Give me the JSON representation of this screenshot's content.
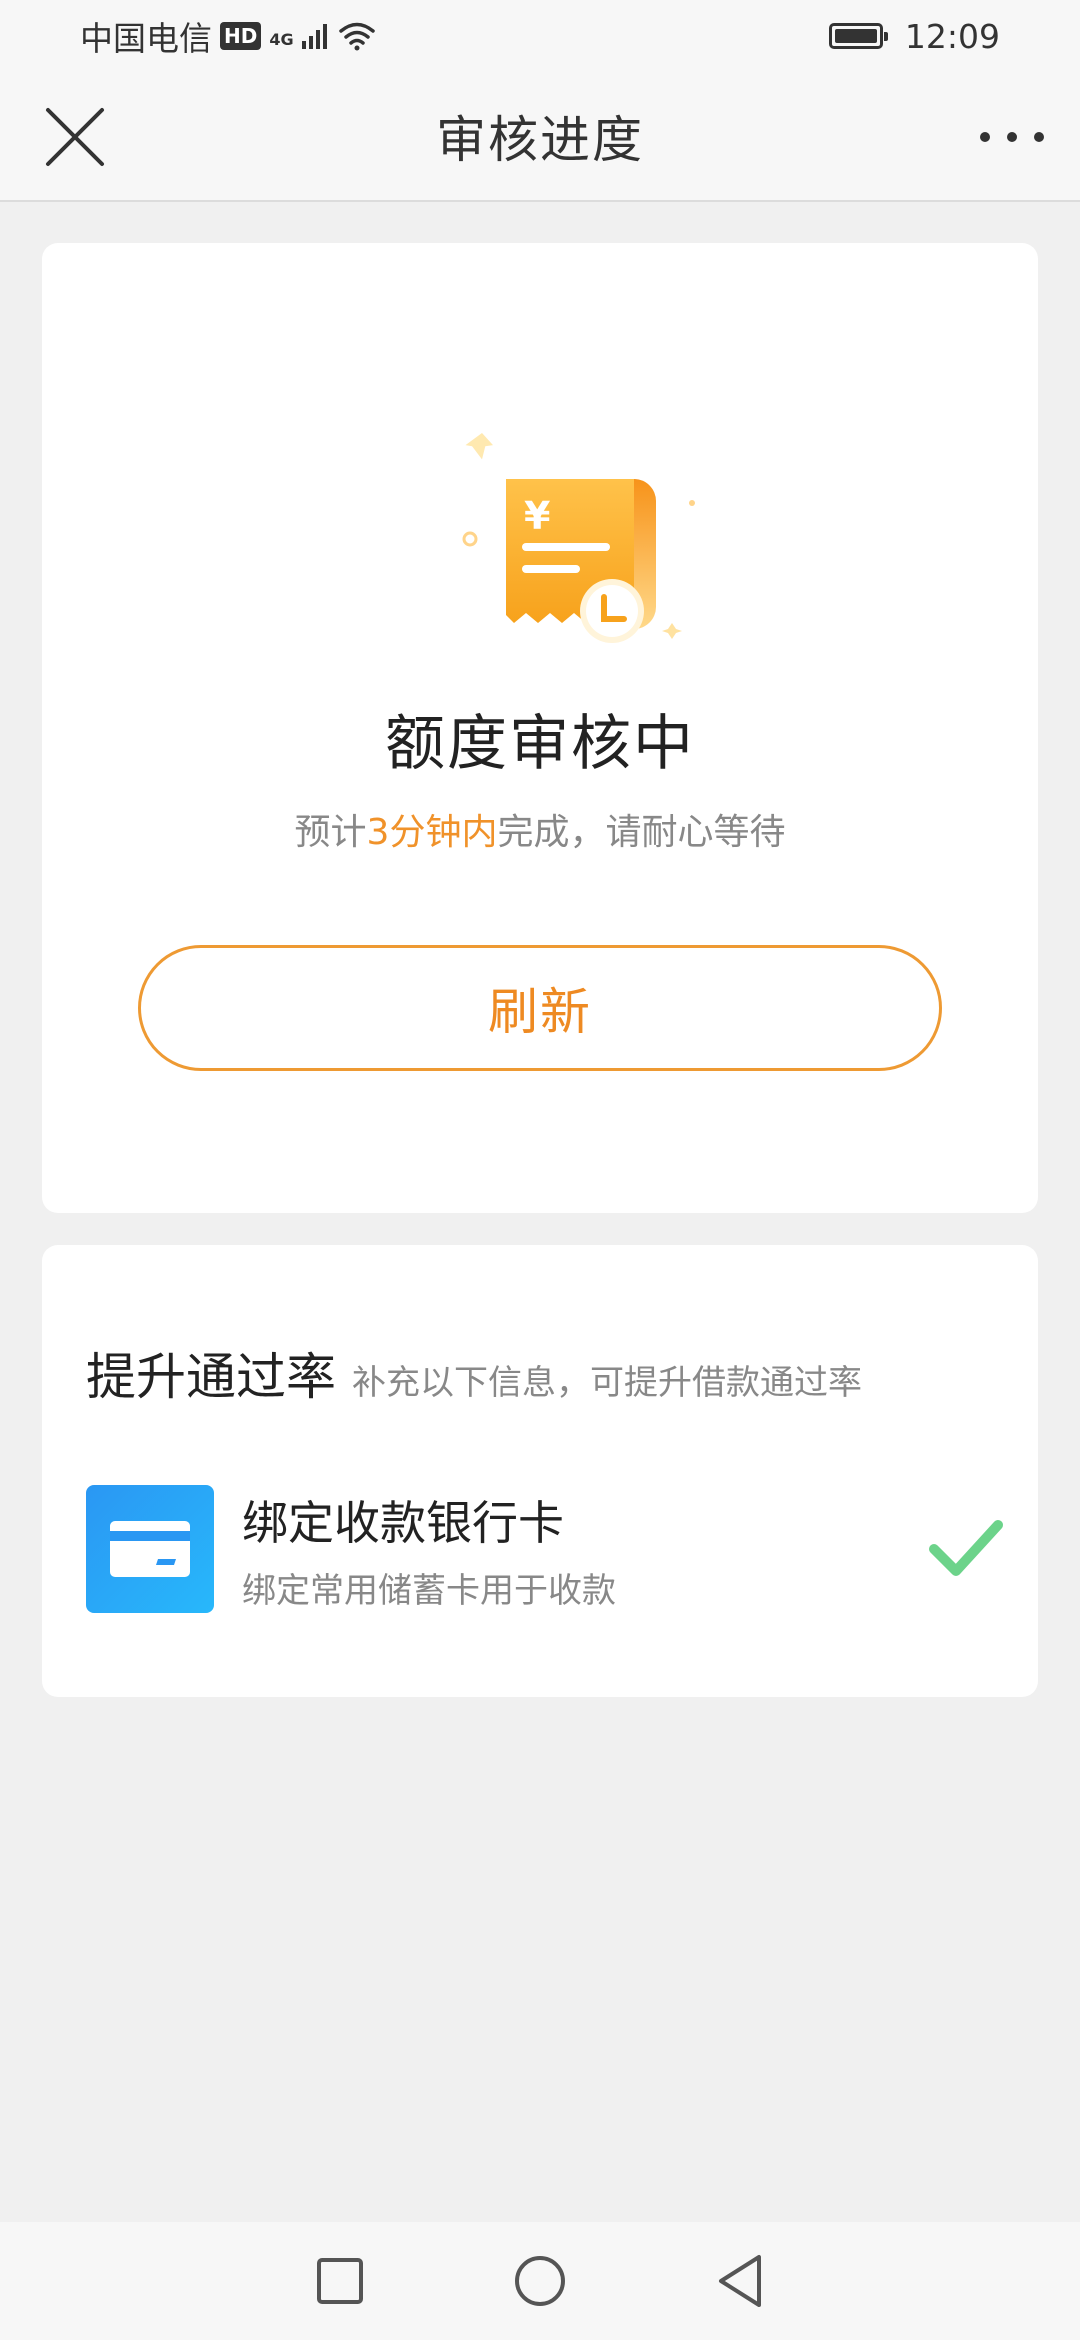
{
  "status_bar": {
    "carrier": "中国电信",
    "hd": "HD",
    "net": "4G",
    "time": "12:09"
  },
  "nav": {
    "title": "审核进度"
  },
  "status_card": {
    "title": "额度审核中",
    "subtitle_prefix": "预计",
    "subtitle_highlight": "3分钟内",
    "subtitle_suffix": "完成，请耐心等待",
    "refresh_label": "刷新"
  },
  "improve_card": {
    "title": "提升通过率",
    "description": "补充以下信息，可提升借款通过率",
    "items": [
      {
        "title": "绑定收款银行卡",
        "description": "绑定常用储蓄卡用于收款",
        "completed": true
      }
    ]
  },
  "colors": {
    "accent": "#ee8a22",
    "check": "#6cd38a",
    "bank_icon": "#2a97f3"
  }
}
